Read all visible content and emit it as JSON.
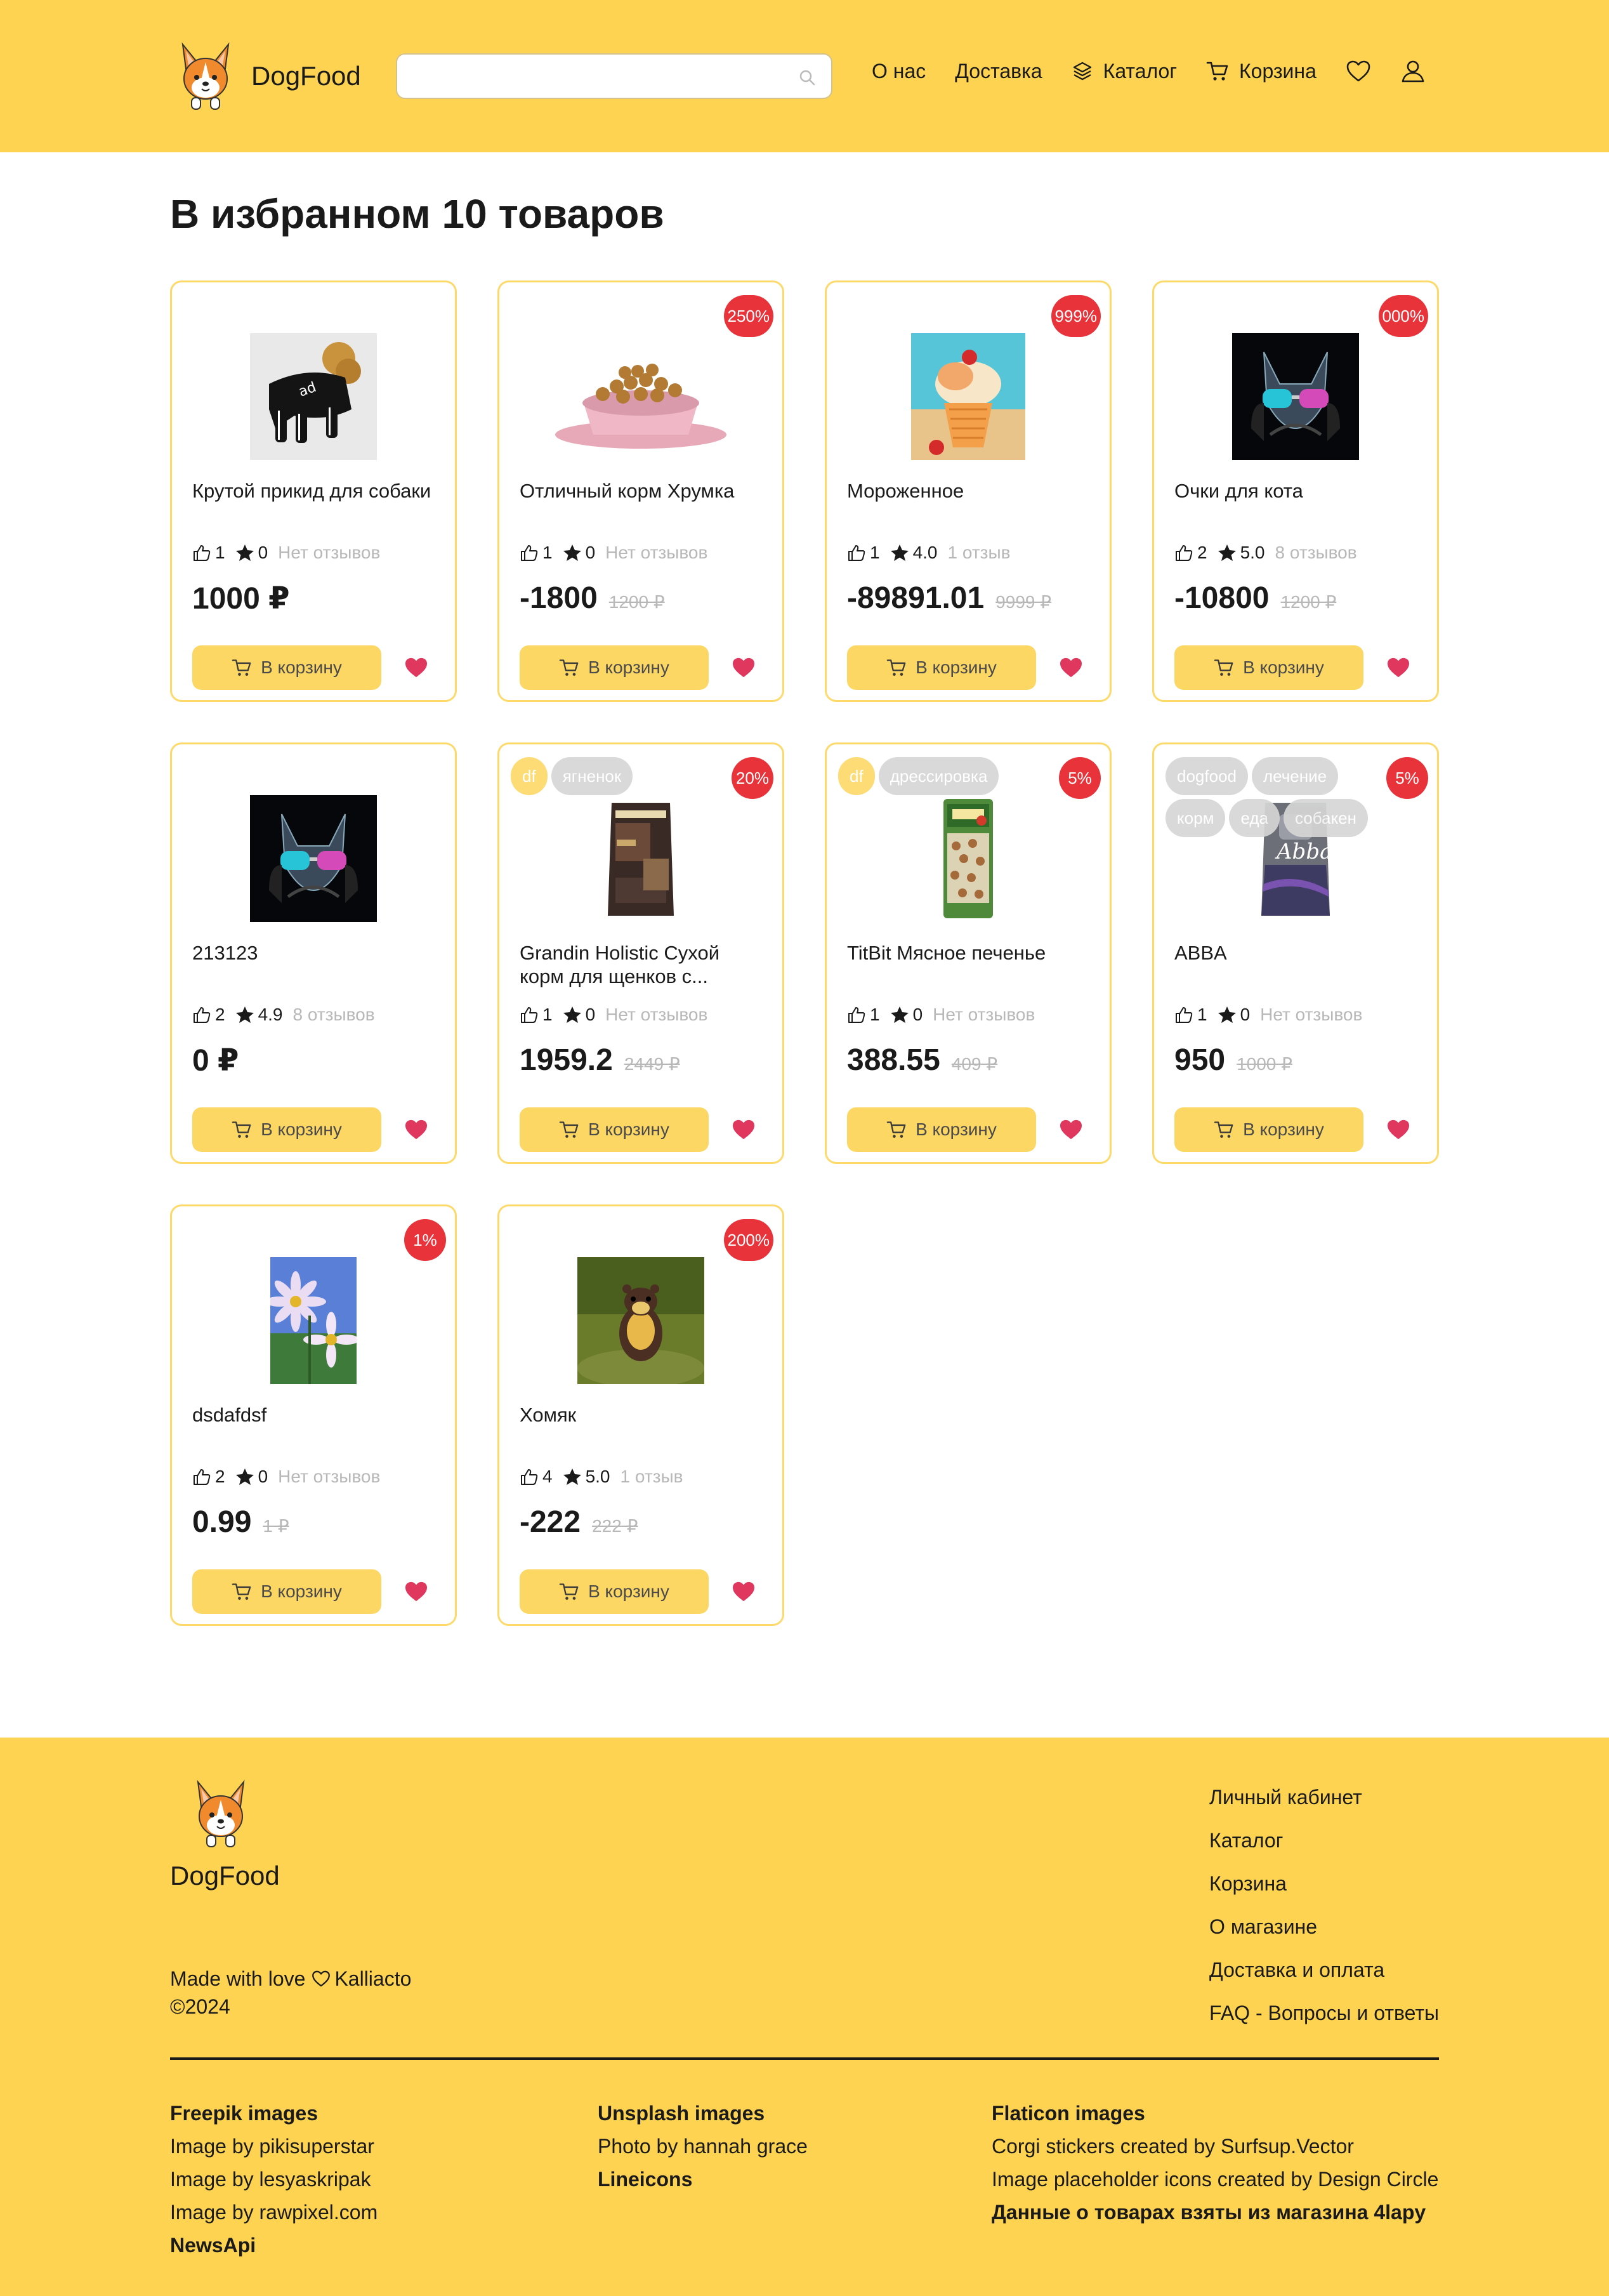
{
  "header": {
    "logo_text": "DogFood",
    "search_placeholder": "",
    "nav": {
      "about": "О нас",
      "delivery": "Доставка",
      "catalog": "Каталог",
      "cart": "Корзина"
    }
  },
  "page": {
    "title": "В избранном 10 товаров"
  },
  "cart_button_label": "В корзину",
  "products": [
    {
      "name": "Крутой прикид для собаки",
      "likes": "1",
      "rating": "0",
      "reviews": "Нет отзывов",
      "price": "1000 ₽",
      "old_price": "",
      "discount": "",
      "tags": [],
      "image": "dog-hoodie"
    },
    {
      "name": "Отличный корм Хрумка",
      "likes": "1",
      "rating": "0",
      "reviews": "Нет отзывов",
      "price": "-1800",
      "old_price": "1200 ₽",
      "discount": "250%",
      "tags": [],
      "image": "food-bowl"
    },
    {
      "name": "Мороженное",
      "likes": "1",
      "rating": "4.0",
      "reviews": "1 отзыв",
      "price": "-89891.01",
      "old_price": "9999 ₽",
      "discount": "999%",
      "tags": [],
      "image": "ice-cream"
    },
    {
      "name": "Очки для кота",
      "likes": "2",
      "rating": "5.0",
      "reviews": "8 отзывов",
      "price": "-10800",
      "old_price": "1200 ₽",
      "discount": "000%",
      "tags": [],
      "image": "cat-glasses"
    },
    {
      "name": "213123",
      "likes": "2",
      "rating": "4.9",
      "reviews": "8 отзывов",
      "price": "0 ₽",
      "old_price": "",
      "discount": "",
      "tags": [],
      "image": "cat-glasses"
    },
    {
      "name": "Grandin Holistic Сухой корм для щенков с...",
      "likes": "1",
      "rating": "0",
      "reviews": "Нет отзывов",
      "price": "1959.2",
      "old_price": "2449 ₽",
      "discount": "20%",
      "tags": [
        "df",
        "ягненок"
      ],
      "image": "food-bag"
    },
    {
      "name": "TitBit Мясное печенье",
      "likes": "1",
      "rating": "0",
      "reviews": "Нет отзывов",
      "price": "388.55",
      "old_price": "409 ₽",
      "discount": "5%",
      "tags": [
        "df",
        "дрессировка"
      ],
      "image": "treat-pack"
    },
    {
      "name": "ABBA",
      "likes": "1",
      "rating": "0",
      "reviews": "Нет отзывов",
      "price": "950",
      "old_price": "1000 ₽",
      "discount": "5%",
      "tags": [
        "dogfood",
        "лечение",
        "корм",
        "еда",
        "собакен"
      ],
      "image": "abba-bag"
    },
    {
      "name": "dsdafdsf",
      "likes": "2",
      "rating": "0",
      "reviews": "Нет отзывов",
      "price": "0.99",
      "old_price": "1 ₽",
      "discount": "1%",
      "tags": [],
      "image": "flowers"
    },
    {
      "name": "Хомяк",
      "likes": "4",
      "rating": "5.0",
      "reviews": "1 отзыв",
      "price": "-222",
      "old_price": "222 ₽",
      "discount": "200%",
      "tags": [],
      "image": "marten"
    }
  ],
  "footer": {
    "logo_text": "DogFood",
    "made_with": "Made with love",
    "author": "Kalliacto",
    "year": "©2024",
    "links": [
      "Личный кабинет",
      "Каталог",
      "Корзина",
      "О магазине",
      "Доставка и оплата",
      "FAQ - Вопросы и ответы"
    ],
    "credits": {
      "col1": {
        "title": "Freepik images",
        "lines": [
          "Image by pikisuperstar",
          "Image by lesyaskripak",
          "Image by rawpixel.com"
        ],
        "extra": "NewsApi"
      },
      "col2": {
        "title": "Unsplash images",
        "lines": [
          "Photo by hannah grace"
        ],
        "extra": "Lineicons"
      },
      "col3": {
        "title": "Flaticon images",
        "lines": [
          "Corgi stickers created by Surfsup.Vector",
          "Image placeholder icons created by Design Circle"
        ],
        "extra": "Данные о товарах взяты из магазина 4lapy"
      }
    }
  },
  "colors": {
    "brand_yellow": "#fed352",
    "discount_red": "#e8333b",
    "heart": "#e0375e"
  }
}
